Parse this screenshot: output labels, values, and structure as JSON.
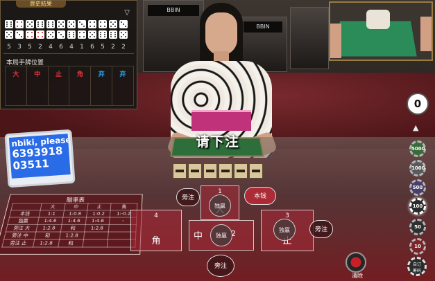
{
  "results_panel": {
    "header": "歷史結果",
    "dice": [
      {
        "a": 6,
        "b": 5,
        "a_red": false,
        "b_red": false
      },
      {
        "a": 4,
        "b": 3,
        "a_red": true,
        "b_red": false
      },
      {
        "a": 5,
        "b": 4,
        "a_red": false,
        "b_red": true
      },
      {
        "a": 6,
        "b": 4,
        "a_red": false,
        "b_red": true
      },
      {
        "a": 6,
        "b": 5,
        "a_red": false,
        "b_red": false
      },
      {
        "a": 5,
        "b": 3,
        "a_red": false,
        "b_red": false
      }
    ],
    "numbers": [
      "5",
      "3",
      "5",
      "2",
      "4",
      "6",
      "4",
      "1",
      "6",
      "5",
      "2",
      "2"
    ],
    "hand_title": "本局手牌位置",
    "hand_columns": [
      {
        "label": "大",
        "color": "#e5323a"
      },
      {
        "label": "中",
        "color": "#e5323a"
      },
      {
        "label": "止",
        "color": "#e5323a"
      },
      {
        "label": "角",
        "color": "#e5323a"
      },
      {
        "label": "弃",
        "color": "#2aa0e8"
      },
      {
        "label": "弃",
        "color": "#2aa0e8"
      }
    ]
  },
  "banner": "请下注",
  "bet_amount": "0",
  "chips": [
    "5000",
    "1000",
    "500",
    "100",
    "50",
    "10"
  ],
  "selected_chip": "100",
  "custom_chip": {
    "line1": "自订",
    "line2": "筹码"
  },
  "name_screen": {
    "line1": "nbiki, please",
    "line2": "6393918",
    "line3": "03511"
  },
  "payout": {
    "title": "賠率表",
    "header": [
      "",
      "大",
      "中",
      "止",
      "角"
    ],
    "rows": [
      [
        "本钱",
        "1:1",
        "1:0.8",
        "1:0.2",
        "1:-0.2"
      ],
      [
        "独赢",
        "1:4.6",
        "1:4.6",
        "1:4.6",
        "-"
      ],
      [
        "旁注 大",
        "1:2.8",
        "和",
        "1:2.8",
        ""
      ],
      [
        "旁注 中",
        "和",
        "1:2.8",
        "",
        ""
      ],
      [
        "旁注 止",
        "1:2.8",
        "和",
        "",
        ""
      ]
    ]
  },
  "zones": {
    "z1": {
      "num": "1",
      "label": "大",
      "inner": "独赢"
    },
    "z2": {
      "num": "2",
      "label": "中",
      "inner": "独赢"
    },
    "z3": {
      "num": "3",
      "label": "止",
      "inner": "独赢"
    },
    "z4": {
      "num": "4",
      "label": "角"
    },
    "side_bet": "旁注",
    "capital": "本钱"
  },
  "clear_label": "清除",
  "colors": {
    "accent_gold": "#9c7b3f",
    "table_red": "#a82837",
    "banner_text": "#ffffff"
  }
}
